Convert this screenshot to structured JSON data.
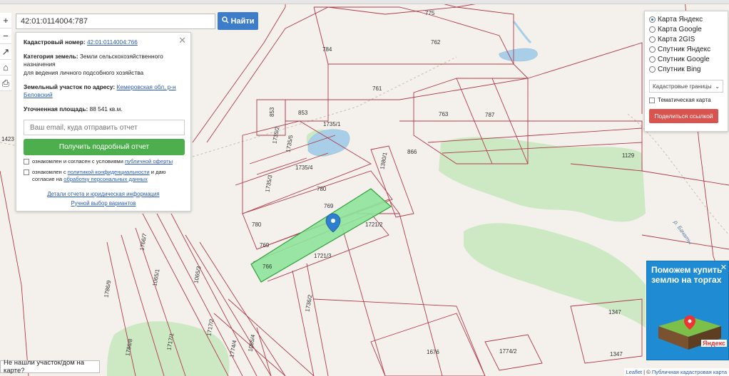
{
  "search": {
    "value": "42:01:0114004:787",
    "button_label": "Найти"
  },
  "toolstrip": {
    "zoom_in": "+",
    "zoom_out": "−",
    "t1": "↗",
    "t2": "⌂",
    "t3": "⎙"
  },
  "info": {
    "cadastral_label": "Кадастровый номер:",
    "cadastral_value": "42:01:0114004:766",
    "category_label": "Категория земель:",
    "category_value": "Земли сельскохозяйственного назначения",
    "usage_value": "для ведения личного подсобного хозяйства",
    "address_label": "Земельный участок по адресу:",
    "address_value": "Кемеровская обл, р-н Беловский",
    "area_label": "Уточненная площадь:",
    "area_value": "88 541 кв.м.",
    "email_placeholder": "Ваш email, куда отправить отчет",
    "report_button": "Получить подробный отчет",
    "consent_offer_prefix": "ознакомлен и согласен с условиями ",
    "consent_offer_link": "публичной оферты",
    "consent_privacy_prefix": "ознакомлен с ",
    "consent_privacy_link": "политикой конфиденциальности",
    "consent_privacy_mid": " и даю согласие на ",
    "consent_privacy_link2": "обработку персональных данных",
    "link_details": "Детали отчета и юридическая информация",
    "link_manual": "Ручной выбор вариантов"
  },
  "layers": {
    "options": [
      "Карта Яндекс",
      "Карта Google",
      "Карта 2GIS",
      "Спутник Яндекс",
      "Спутник Google",
      "Спутник Bing"
    ],
    "selected_index": 0,
    "select_value": "Кадастровые границы",
    "thematic_label": "Тематическая карта",
    "share_button": "Поделиться ссылкой"
  },
  "ad": {
    "text": "Поможем купить землю на торгах",
    "brand": "Яндекс"
  },
  "bottom_button": "Не нашли участок/дом на карте?",
  "attribution": {
    "leaflet": "Leaflet",
    "sep": " | © ",
    "pkk": "Публичная кадастровая карта"
  },
  "parcels": {
    "p775": "775",
    "p784": "784",
    "p762": "762",
    "p761": "761",
    "p763": "763",
    "p787": "787",
    "p853a": "853",
    "p853b": "853",
    "p1735_1": "1735/1",
    "p1735_2": "1735/2",
    "p1735_4": "1735/4",
    "p1735_5": "1735/5",
    "p1735_3": "1735/3",
    "p1380_1": "1380/1",
    "p866": "866",
    "p1129": "1129",
    "p780a": "780",
    "p780b": "780",
    "p769a": "769",
    "p769b": "769",
    "p766": "766",
    "p1721_2": "1721/2",
    "p1721_3": "1721/3",
    "p1423": "1423",
    "p1347a": "1347",
    "p1347b": "1347",
    "p1676": "1676",
    "p1774_2": "1774/2",
    "p1065_3": "1065/3",
    "p1065_1": "1065/1",
    "p1065_4": "1065/4",
    "p1717_2": "1717/2",
    "p1717_1": "1717/1",
    "p1786_9": "1786/9",
    "p1786_8": "1786/8",
    "p1766_7": "1766/7",
    "p1774_4": "1774/4",
    "p1736_2": "1736/2",
    "river": "р. Бачаты"
  }
}
